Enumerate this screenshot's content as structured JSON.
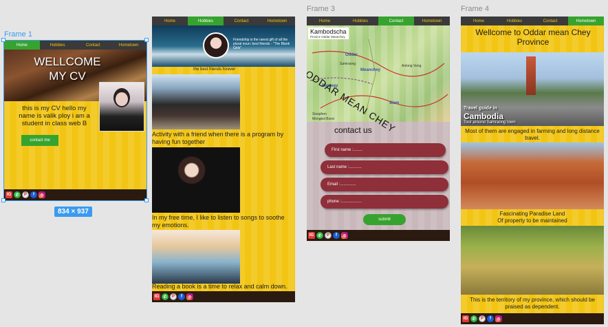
{
  "frames": {
    "f1": {
      "label": "Frame 1",
      "dimensions": "834 × 937"
    },
    "f3": {
      "label": "Frame 3"
    },
    "f4": {
      "label": "Frame 4"
    }
  },
  "nav": {
    "home": "Home",
    "hobbies": "Hobbies",
    "contact": "Contact",
    "hometown": "Hometown"
  },
  "frame1": {
    "title_line1": "WELLCOME",
    "title_line2": "MY CV",
    "intro": "this is my CV hello my name is valik ploy i am a student in class web B",
    "contact_button": "contact me"
  },
  "frame2": {
    "banner_quote": "Friendship is the rarest gift of all the plural noun: best friends - \"The Blank Girls\"",
    "banner_caption": "the best friends forever",
    "cap1": "Activity with a friend when there is a program by having fun together",
    "cap2": "In my free time, I like to listen to songs to soothe my emotions.",
    "cap3": "Reading a book is a time to relax and calm down."
  },
  "frame3": {
    "map_title": "Kambodscha",
    "map_subtitle": "Provinz Oddar Meanchey",
    "map_overlay": "ODDAR MEAN CHEY",
    "map_places": [
      "Oddar",
      "Meanchey",
      "Samraong",
      "Banteay",
      "Anlong Veng",
      "Siem",
      "Sisophon",
      "Mongkol Borei"
    ],
    "heading": "contact us",
    "first_name": "First name :........",
    "last_name": "Last name :...........",
    "email": "Email :..............",
    "phone": "phone :..................",
    "submit": "submit"
  },
  "frame4": {
    "title": "Wellcome to Oddar mean Chey Province",
    "travel_guide": "Travel guide in",
    "cambodia": "Cambodia",
    "samraong": "Tour around Samraong town",
    "text1": "Most of them are engaged in farming and long distance travel.",
    "text2a": "Fascinating Paradise Land",
    "text2b": "Of property to be maintained",
    "text3": "This is the territory of my province, which should be praised as dependent."
  },
  "social": [
    "IG",
    "whatsapp",
    "pinterest",
    "f",
    "instagram"
  ],
  "colors": {
    "frame_bg": "#f2c514",
    "nav_bg": "#3a3a3a",
    "active_green": "#37a32f",
    "field_maroon": "#8e2f3a",
    "selection_blue": "#3a9bf0"
  }
}
